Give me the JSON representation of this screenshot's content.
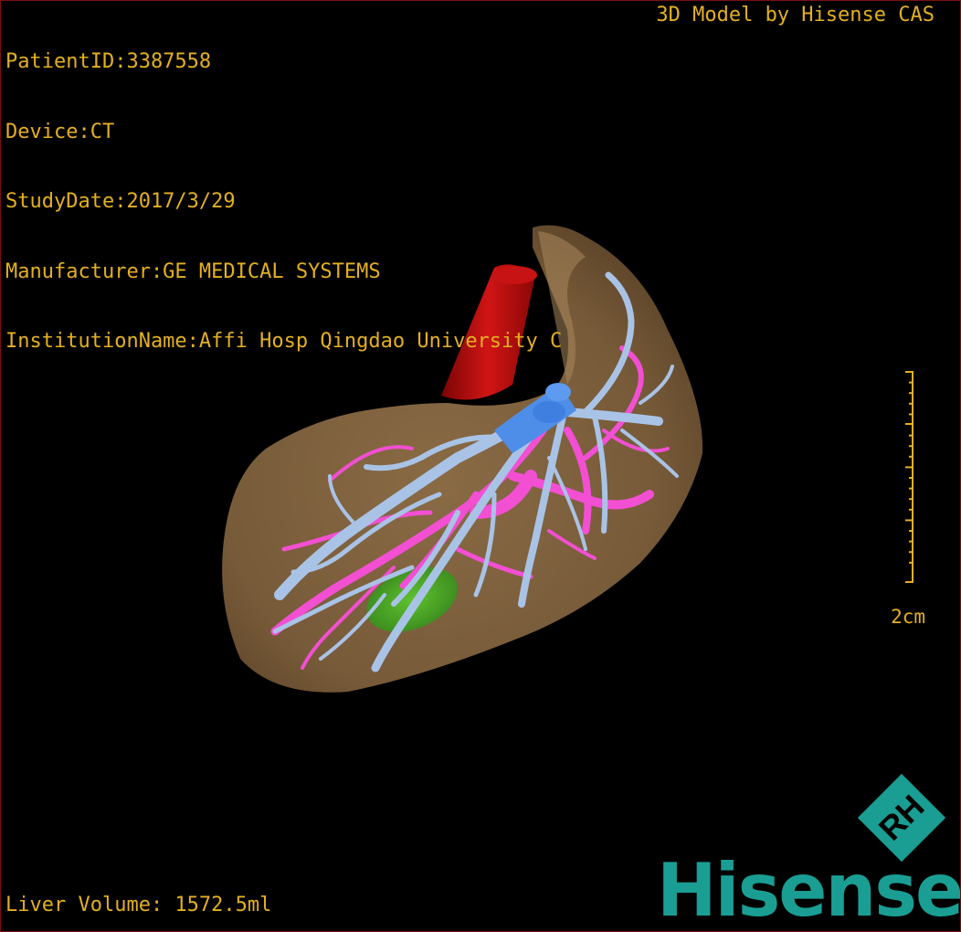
{
  "study_info": {
    "patient_id": "PatientID:3387558",
    "device": "Device:CT",
    "study_date": "StudyDate:2017/3/29",
    "manufacturer": "Manufacturer:GE MEDICAL SYSTEMS",
    "institution": "InstitutionName:Affi Hosp Qingdao University C"
  },
  "credit": "3D Model by Hisense CAS",
  "scale_bar": {
    "label": "2cm",
    "color": "#e3b021"
  },
  "liver_volume": "Liver Volume: 1572.5ml",
  "brand": {
    "word": "Hisense",
    "emblem_text": "RH",
    "color": "#1a9e94"
  },
  "model_colors": {
    "liver": "#8a6a44",
    "aorta": "#b40c0c",
    "portal_vein": "#a9c3e6",
    "hepatic_vein": "#f24fd2",
    "gallbladder": "#44aa26",
    "vein_root": "#4f8ee8"
  }
}
